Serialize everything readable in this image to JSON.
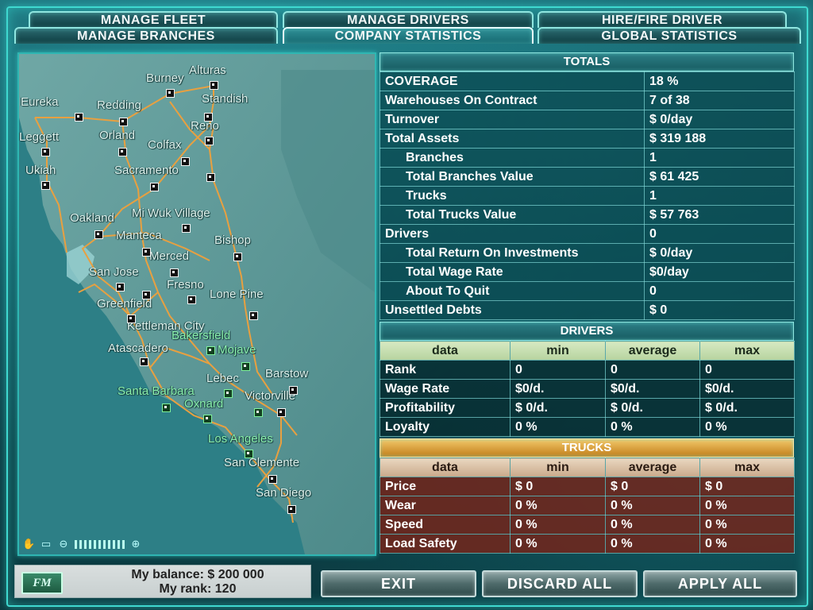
{
  "tabs": {
    "manage_fleet": "MANAGE FLEET",
    "manage_drivers": "MANAGE DRIVERS",
    "hire_fire": "HIRE/FIRE DRIVER",
    "manage_branches": "MANAGE BRANCHES",
    "company_statistics": "COMPANY STATISTICS",
    "global_statistics": "GLOBAL STATISTICS",
    "active": "company_statistics"
  },
  "map": {
    "cities": [
      {
        "name": "Alturas"
      },
      {
        "name": "Burney"
      },
      {
        "name": "Eureka"
      },
      {
        "name": "Redding"
      },
      {
        "name": "Standish"
      },
      {
        "name": "Reno"
      },
      {
        "name": "Leggett"
      },
      {
        "name": "Orland"
      },
      {
        "name": "Colfax"
      },
      {
        "name": "Ukiah"
      },
      {
        "name": "Sacramento"
      },
      {
        "name": "Oakland"
      },
      {
        "name": "Mi Wuk Village"
      },
      {
        "name": "Manteca"
      },
      {
        "name": "Bishop"
      },
      {
        "name": "Merced"
      },
      {
        "name": "San Jose"
      },
      {
        "name": "Fresno"
      },
      {
        "name": "Lone Pine"
      },
      {
        "name": "Greenfield"
      },
      {
        "name": "Kettleman City"
      },
      {
        "name": "Bakersfield"
      },
      {
        "name": "Atascadero"
      },
      {
        "name": "Mojave"
      },
      {
        "name": "Lebec"
      },
      {
        "name": "Barstow"
      },
      {
        "name": "Santa Barbara"
      },
      {
        "name": "Victorville"
      },
      {
        "name": "Oxnard"
      },
      {
        "name": "Los Angeles"
      },
      {
        "name": "San Clemente"
      },
      {
        "name": "San Diego"
      }
    ]
  },
  "totals": {
    "header": "TOTALS",
    "rows": [
      {
        "label": "COVERAGE",
        "value": "18 %",
        "indent": false
      },
      {
        "label": "Warehouses On Contract",
        "value": "7 of 38",
        "indent": false
      },
      {
        "label": "Turnover",
        "value": "$ 0/day",
        "indent": false
      },
      {
        "label": "Total Assets",
        "value": "$ 319 188",
        "indent": false
      },
      {
        "label": "Branches",
        "value": "1",
        "indent": true
      },
      {
        "label": "Total Branches Value",
        "value": "$ 61 425",
        "indent": true
      },
      {
        "label": "Trucks",
        "value": "1",
        "indent": true
      },
      {
        "label": "Total Trucks Value",
        "value": "$ 57 763",
        "indent": true
      },
      {
        "label": "Drivers",
        "value": "0",
        "indent": false
      },
      {
        "label": "Total Return On Investments",
        "value": "$ 0/day",
        "indent": true
      },
      {
        "label": "Total Wage Rate",
        "value": "$0/day",
        "indent": true
      },
      {
        "label": "About To Quit",
        "value": "0",
        "indent": true
      },
      {
        "label": "Unsettled Debts",
        "value": "$ 0",
        "indent": false
      }
    ]
  },
  "drivers": {
    "header": "DRIVERS",
    "columns": [
      "data",
      "min",
      "average",
      "max"
    ],
    "rows": [
      [
        "Rank",
        "0",
        "0",
        "0"
      ],
      [
        "Wage Rate",
        "$0/d.",
        "$0/d.",
        "$0/d."
      ],
      [
        "Profitability",
        "$ 0/d.",
        "$ 0/d.",
        "$ 0/d."
      ],
      [
        "Loyalty",
        "0 %",
        "0 %",
        "0 %"
      ]
    ]
  },
  "trucks": {
    "header": "TRUCKS",
    "columns": [
      "data",
      "min",
      "average",
      "max"
    ],
    "rows": [
      [
        "Price",
        "$ 0",
        "$ 0",
        "$ 0"
      ],
      [
        "Wear",
        "0 %",
        "0 %",
        "0 %"
      ],
      [
        "Speed",
        "0 %",
        "0 %",
        "0 %"
      ],
      [
        "Load Safety",
        "0 %",
        "0 %",
        "0 %"
      ]
    ]
  },
  "footer": {
    "logo": "FM",
    "balance": "My balance: $ 200 000",
    "rank": "My rank: 120",
    "exit": "EXIT",
    "discard_all": "DISCARD ALL",
    "apply_all": "APPLY ALL"
  },
  "colors": {
    "frame": "#3fd9d0",
    "trucks_header": "#e3a43a",
    "route": "#e8a040"
  }
}
